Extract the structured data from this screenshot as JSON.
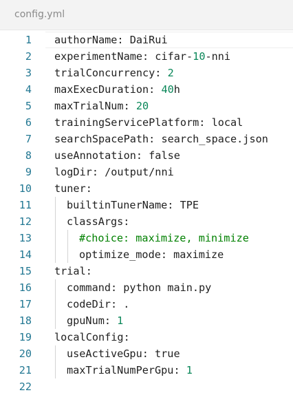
{
  "tab": {
    "title": "config.yml"
  },
  "lines": [
    {
      "num": "1",
      "indent": 0,
      "parts": [
        {
          "t": "authorName: DaiRui",
          "c": "txt"
        }
      ]
    },
    {
      "num": "2",
      "indent": 0,
      "parts": [
        {
          "t": "experimentName: cifar-",
          "c": "txt"
        },
        {
          "t": "10",
          "c": "num"
        },
        {
          "t": "-nni",
          "c": "txt"
        }
      ]
    },
    {
      "num": "3",
      "indent": 0,
      "parts": [
        {
          "t": "trialConcurrency: ",
          "c": "txt"
        },
        {
          "t": "2",
          "c": "num"
        }
      ]
    },
    {
      "num": "4",
      "indent": 0,
      "parts": [
        {
          "t": "maxExecDuration: ",
          "c": "txt"
        },
        {
          "t": "40",
          "c": "num"
        },
        {
          "t": "h",
          "c": "txt"
        }
      ]
    },
    {
      "num": "5",
      "indent": 0,
      "parts": [
        {
          "t": "maxTrialNum: ",
          "c": "txt"
        },
        {
          "t": "20",
          "c": "num"
        }
      ]
    },
    {
      "num": "6",
      "indent": 0,
      "parts": [
        {
          "t": "trainingServicePlatform: local",
          "c": "txt"
        }
      ]
    },
    {
      "num": "7",
      "indent": 0,
      "parts": [
        {
          "t": "searchSpacePath: search_space.json",
          "c": "txt"
        }
      ]
    },
    {
      "num": "8",
      "indent": 0,
      "parts": [
        {
          "t": "useAnnotation: false",
          "c": "txt"
        }
      ]
    },
    {
      "num": "9",
      "indent": 0,
      "parts": [
        {
          "t": "logDir: /output/nni",
          "c": "txt"
        }
      ]
    },
    {
      "num": "10",
      "indent": 0,
      "parts": [
        {
          "t": "tuner:",
          "c": "txt"
        }
      ]
    },
    {
      "num": "11",
      "indent": 1,
      "parts": [
        {
          "t": "builtinTunerName: TPE",
          "c": "txt"
        }
      ]
    },
    {
      "num": "12",
      "indent": 1,
      "parts": [
        {
          "t": "classArgs:",
          "c": "txt"
        }
      ]
    },
    {
      "num": "13",
      "indent": 2,
      "parts": [
        {
          "t": "#choice: maximize, minimize",
          "c": "cmt"
        }
      ]
    },
    {
      "num": "14",
      "indent": 2,
      "parts": [
        {
          "t": "optimize_mode: maximize",
          "c": "txt"
        }
      ]
    },
    {
      "num": "15",
      "indent": 0,
      "parts": [
        {
          "t": "trial:",
          "c": "txt"
        }
      ]
    },
    {
      "num": "16",
      "indent": 1,
      "parts": [
        {
          "t": "command: python main.py",
          "c": "txt"
        }
      ]
    },
    {
      "num": "17",
      "indent": 1,
      "parts": [
        {
          "t": "codeDir: .",
          "c": "txt"
        }
      ]
    },
    {
      "num": "18",
      "indent": 1,
      "parts": [
        {
          "t": "gpuNum: ",
          "c": "txt"
        },
        {
          "t": "1",
          "c": "num"
        }
      ]
    },
    {
      "num": "19",
      "indent": 0,
      "parts": [
        {
          "t": "localConfig:",
          "c": "txt"
        }
      ]
    },
    {
      "num": "20",
      "indent": 1,
      "parts": [
        {
          "t": "useActiveGpu: true",
          "c": "txt"
        }
      ]
    },
    {
      "num": "21",
      "indent": 1,
      "parts": [
        {
          "t": "maxTrialNumPerGpu: ",
          "c": "txt"
        },
        {
          "t": "1",
          "c": "num"
        }
      ]
    },
    {
      "num": "22",
      "indent": 0,
      "parts": []
    }
  ],
  "colors": {
    "line_number": "#237893",
    "text": "#1f1f1f",
    "number": "#098658",
    "comment": "#008000",
    "indent_guide": "#d3d3d3"
  }
}
